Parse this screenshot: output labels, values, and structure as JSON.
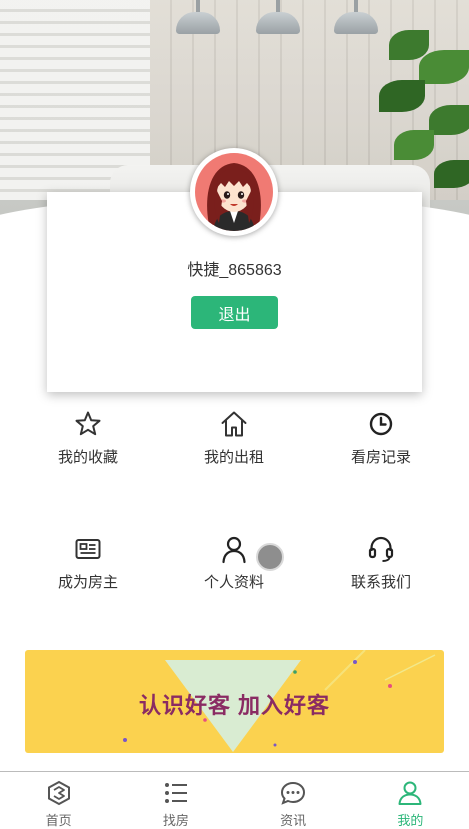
{
  "profile": {
    "username": "快捷_865863",
    "logout_label": "退出"
  },
  "menu": [
    {
      "label": "我的收藏",
      "icon": "star-icon"
    },
    {
      "label": "我的出租",
      "icon": "home-icon"
    },
    {
      "label": "看房记录",
      "icon": "clock-icon"
    },
    {
      "label": "成为房主",
      "icon": "id-card-icon"
    },
    {
      "label": "个人资料",
      "icon": "user-icon"
    },
    {
      "label": "联系我们",
      "icon": "headset-icon"
    }
  ],
  "banner": {
    "text": "认识好客 加入好客"
  },
  "tabs": [
    {
      "label": "首页",
      "icon": "hexagon-logo-icon"
    },
    {
      "label": "找房",
      "icon": "list-icon"
    },
    {
      "label": "资讯",
      "icon": "chat-icon"
    },
    {
      "label": "我的",
      "icon": "person-icon",
      "active": true
    }
  ],
  "colors": {
    "accent": "#2cb679",
    "banner_bg": "#fbd24f",
    "banner_text": "#8a2b63"
  }
}
